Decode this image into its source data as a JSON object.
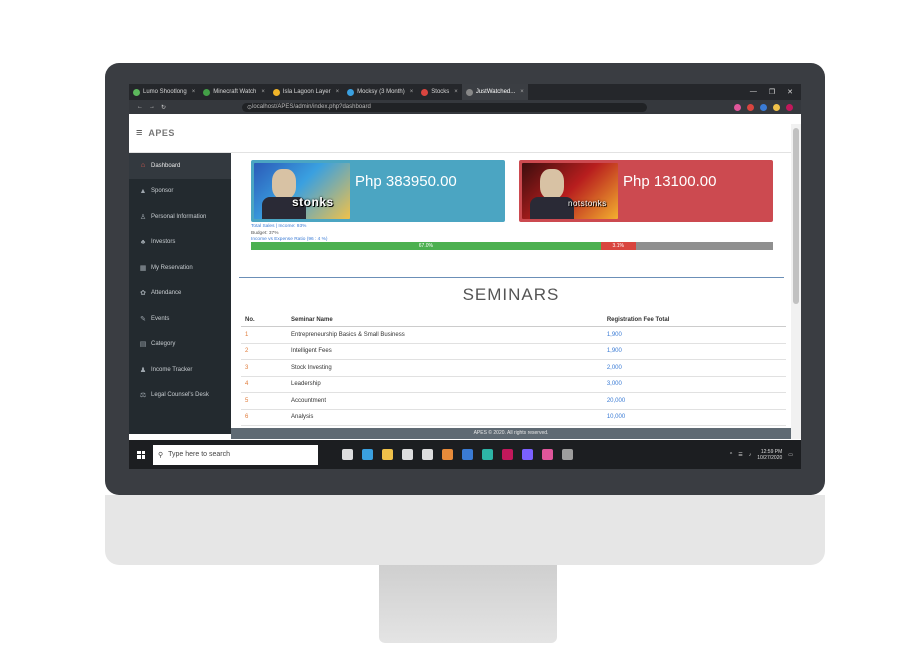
{
  "browser": {
    "tabs": [
      {
        "label": "Lumo Shootlong",
        "color": "#5cb85c"
      },
      {
        "label": "Minecraft Watch",
        "color": "#43a047"
      },
      {
        "label": "Isla Lagoon Layer",
        "color": "#f0b429"
      },
      {
        "label": "Mocksy (3 Month)",
        "color": "#3aa0e0"
      },
      {
        "label": "Stocks",
        "color": "#d9453f"
      },
      {
        "label": "JustWatched...",
        "color": "#888888",
        "active": true
      }
    ],
    "address": "localhost/APES/admin/index.php?dashboard",
    "window_controls": [
      "—",
      "❐",
      "✕"
    ]
  },
  "app": {
    "logo": "APES",
    "sidebar": [
      {
        "label": "Dashboard",
        "icon": "⌂",
        "active": true
      },
      {
        "label": "Sponsor",
        "icon": "▲"
      },
      {
        "label": "Personal Information",
        "icon": "♙"
      },
      {
        "label": "Investors",
        "icon": "♣"
      },
      {
        "label": "My Reservation",
        "icon": "▦"
      },
      {
        "label": "Attendance",
        "icon": "✿"
      },
      {
        "label": "Events",
        "icon": "✎"
      },
      {
        "label": "Category",
        "icon": "▤"
      },
      {
        "label": "Income Tracker",
        "icon": "♟"
      },
      {
        "label": "Legal Counsel's Desk",
        "icon": "⚖"
      }
    ],
    "cards": [
      {
        "word": "stonks",
        "amount": "Php 383950.00"
      },
      {
        "word": "notstonks",
        "amount": "Php 13100.00"
      }
    ],
    "meta": {
      "line1": "Total Sales | Income: 93%",
      "line2": "Budget: 37%",
      "line3": "Income vs Expense Ratio (96 : 4 %)"
    },
    "progress": {
      "income_percent": 67,
      "expense_percent": 1,
      "income_label": "67.0%",
      "expense_label": "3.1%"
    },
    "seminars": {
      "title": "SEMINARS",
      "columns": [
        "No.",
        "Seminar Name",
        "Registration Fee Total"
      ],
      "rows": [
        [
          "1",
          "Entrepreneurship Basics & Small Business",
          "1,900"
        ],
        [
          "2",
          "Intelligent Fees",
          "1,900"
        ],
        [
          "3",
          "Stock Investing",
          "2,000"
        ],
        [
          "4",
          "Leadership",
          "3,000"
        ],
        [
          "5",
          "Accountment",
          "20,000"
        ],
        [
          "6",
          "Analysis",
          "10,000"
        ]
      ]
    },
    "footer": "APES © 2020. All rights reserved."
  },
  "taskbar": {
    "search_placeholder": "Type here to search",
    "apps": [
      "#ffffff",
      "#3aa0e0",
      "#f0c14a",
      "#ffffff",
      "#ffffff",
      "#e88b3a",
      "#3a7bd5",
      "#2db4a6",
      "#c2185b",
      "#7b61ff",
      "#e0569b",
      "#9e9e9e"
    ],
    "time": "12:59 PM",
    "date": "10/27/2020"
  }
}
